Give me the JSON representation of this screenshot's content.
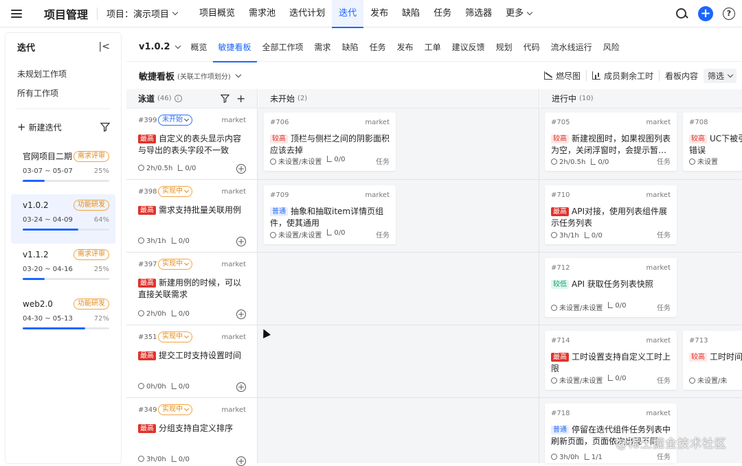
{
  "topbar": {
    "app_title": "项目管理",
    "project_label": "项目：演示项目",
    "nav": [
      "项目概览",
      "需求池",
      "迭代计划",
      "迭代",
      "发布",
      "缺陷",
      "任务",
      "筛选器",
      "更多"
    ]
  },
  "sidebar": {
    "title": "迭代",
    "links": [
      "未规划工作项",
      "所有工作项"
    ],
    "new_iteration": "新建迭代",
    "iterations": [
      {
        "name": "官网项目二期",
        "status": "需求评审",
        "dates": "03-07 ~ 05-07",
        "percent_text": "25%",
        "progress": 0.25
      },
      {
        "name": "v1.0.2",
        "status": "功能研发",
        "dates": "03-24 ~ 04-09",
        "percent_text": "64%",
        "progress": 0.64
      },
      {
        "name": "v1.1.2",
        "status": "需求评审",
        "dates": "03-20 ~ 04-16",
        "percent_text": "25%",
        "progress": 0.25
      },
      {
        "name": "web2.0",
        "status": "功能研发",
        "dates": "04-30 ~ 05-13",
        "percent_text": "72%",
        "progress": 0.72
      }
    ]
  },
  "subnav": {
    "version": "v1.0.2",
    "tabs": [
      "概览",
      "敏捷看板",
      "全部工作项",
      "需求",
      "缺陷",
      "任务",
      "发布",
      "工单",
      "建议反馈",
      "规划",
      "代码",
      "流水线运行",
      "风险"
    ]
  },
  "board": {
    "title": "敏捷看板",
    "subtitle": "(关联工作项划分)",
    "burndown": "燃尽图",
    "remaining": "成员剩余工时",
    "content_label": "看板内容",
    "filter": "筛选"
  },
  "columns": {
    "lane": {
      "label": "泳道",
      "count": "(46)"
    },
    "todo": {
      "label": "未开始",
      "count": "(2)"
    },
    "doing": {
      "label": "进行中",
      "count": "(10)"
    }
  },
  "lanes": [
    {
      "id": "#399",
      "status": "未开始",
      "market": "market",
      "priority": "最高",
      "title": "自定义的表头显示内容与导出的表头字段不一致",
      "time": "2h/0.5h",
      "sub": "0/0"
    },
    {
      "id": "#398",
      "status": "实现中",
      "market": "market",
      "priority": "最高",
      "title": "需求支持批量关联用例",
      "time": "3h/1h",
      "sub": "0/0"
    },
    {
      "id": "#397",
      "status": "实现中",
      "market": "market",
      "priority": "最高",
      "title": "新建用例的时候，可以直接关联需求",
      "time": "2h/0h",
      "sub": "0/0"
    },
    {
      "id": "#351",
      "status": "实现中",
      "market": "market",
      "priority": "最高",
      "title": "提交工时支持设置时间",
      "time": "0h/0h",
      "sub": "0/0"
    },
    {
      "id": "#349",
      "status": "实现中",
      "market": "market",
      "priority": "最高",
      "title": "分组支持自定义排序",
      "time": "3h/0h",
      "sub": "0/0"
    }
  ],
  "cards": [
    {
      "id": "#706",
      "market": "market",
      "priority": "较高",
      "title": "顶栏与侧栏之间的阴影面积应该去掉",
      "time": "未设置/未设置",
      "sub": "0/0",
      "type": "任务"
    },
    {
      "id": "#709",
      "market": "market",
      "priority": "普通",
      "title": "抽象和抽取item详情页组件，使其通用",
      "time": "未设置/未设置",
      "sub": "0/0",
      "type": "任务"
    },
    {
      "id": "#705",
      "market": "market",
      "priority": "较高",
      "title": "新建视图时，如果视图列表为空，关闭浮窗时，会提示暂…",
      "time": "2h/0.5h",
      "sub": "0/0",
      "type": "任务"
    },
    {
      "id": "#708",
      "market": "",
      "priority": "较高",
      "title": "UC下被引错误",
      "time": "未设置",
      "sub": "",
      "type": ""
    },
    {
      "id": "#710",
      "market": "market",
      "priority": "最高",
      "title": "API对接，使用列表组件展示任务列表",
      "time": "3h/1h",
      "sub": "0/0",
      "type": "任务"
    },
    {
      "id": "#712",
      "market": "market",
      "priority": "较低",
      "title": "API 获取任务列表快照",
      "time": "未设置/未设置",
      "sub": "0/0",
      "type": "任务"
    },
    {
      "id": "#714",
      "market": "market",
      "priority": "最高",
      "title": "工时设置支持自定义工时上限",
      "time": "未设置/未设置",
      "sub": "0/0",
      "type": "任务"
    },
    {
      "id": "#713",
      "market": "",
      "priority": "较高",
      "title": "工时时间",
      "time": "未设置/未",
      "sub": "",
      "type": ""
    },
    {
      "id": "#718",
      "market": "market",
      "priority": "普通",
      "title": "停留在迭代组件任务列表中刷新页面，页面依次出现不同",
      "time": "3h/0h",
      "sub": "1/1",
      "type": "任务"
    }
  ],
  "watermark": "@稀土掘金技术社区"
}
